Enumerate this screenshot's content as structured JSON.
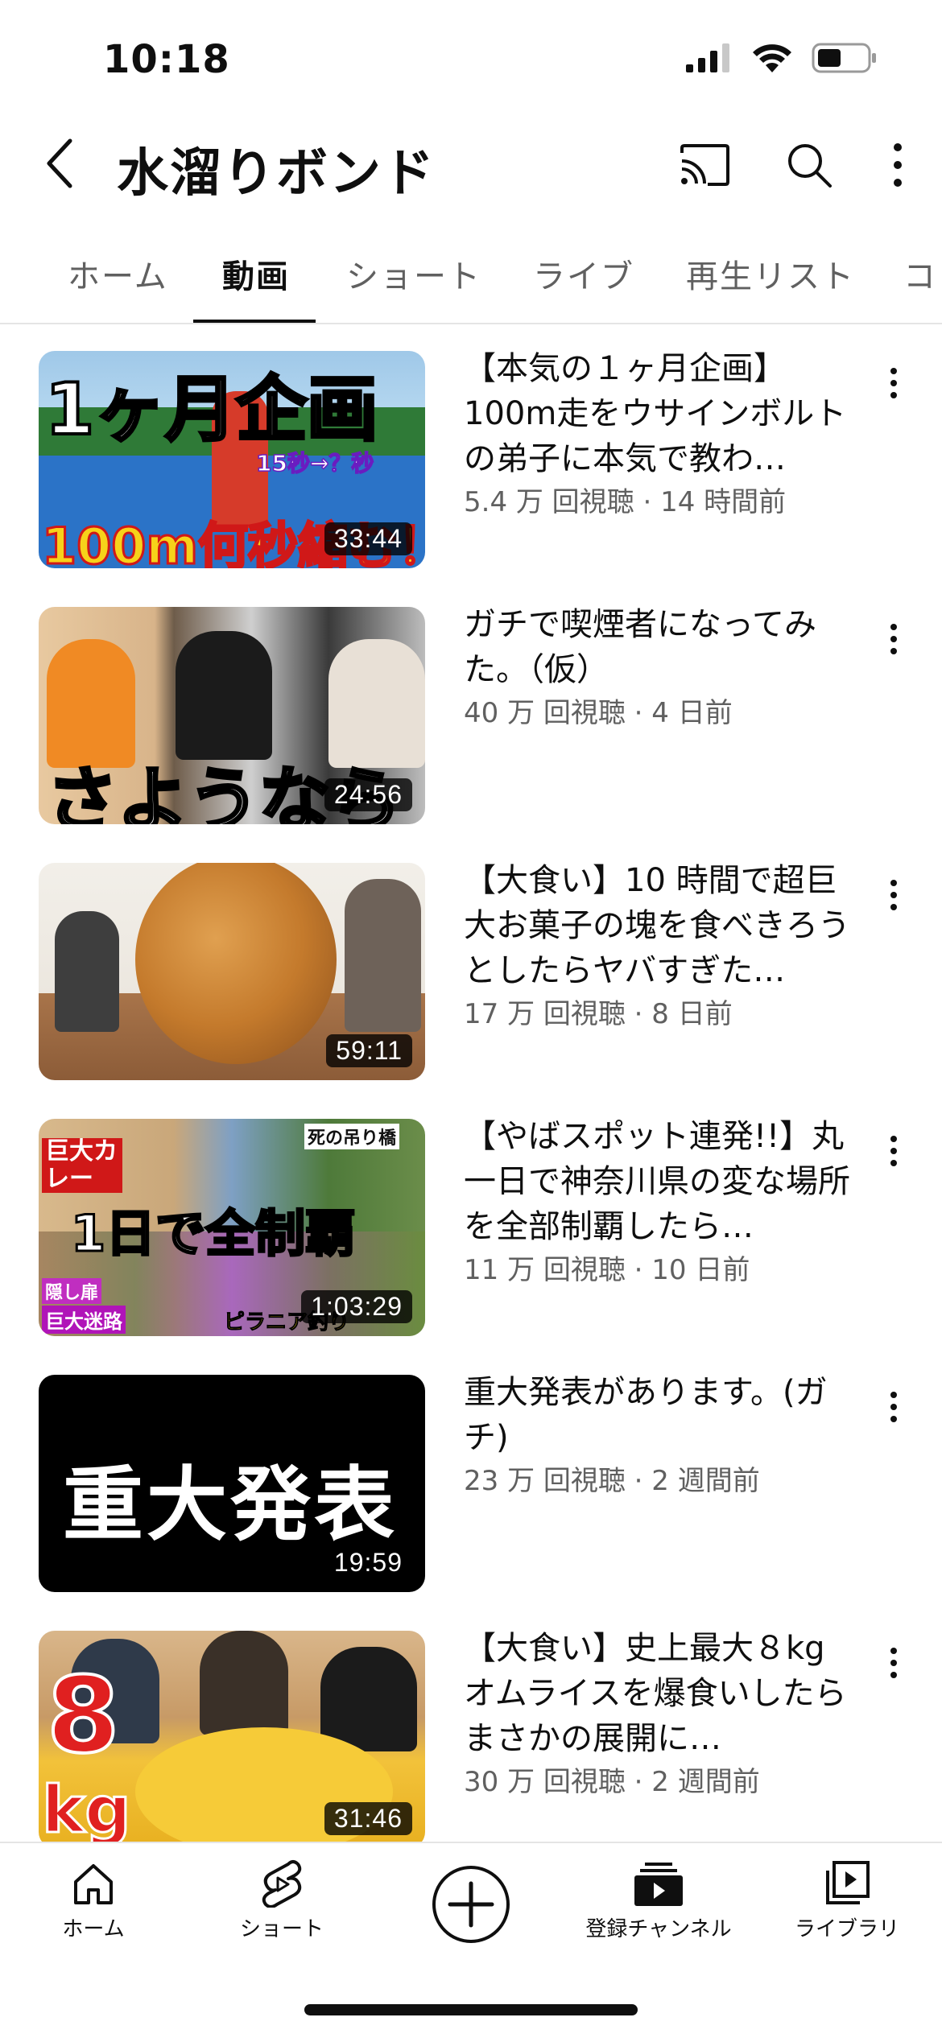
{
  "status": {
    "time": "10:18"
  },
  "header": {
    "title": "水溜りボンド"
  },
  "tabs": [
    {
      "label": "ホーム"
    },
    {
      "label": "動画",
      "active": true
    },
    {
      "label": "ショート"
    },
    {
      "label": "ライブ"
    },
    {
      "label": "再生リスト"
    },
    {
      "label": "コミュ"
    }
  ],
  "videos": [
    {
      "title": "【本気の１ヶ月企画】100m走をウサインボルトの弟子に本気で教わ…",
      "meta": "5.4 万 回視聴 · 14 時間前",
      "duration": "33:44",
      "thumb_text": {
        "top": "1ヶ月企画",
        "bottom": "100m何秒縮む！",
        "small": "15秒→？秒"
      }
    },
    {
      "title": "ガチで喫煙者になってみた。（仮）",
      "meta": "40 万 回視聴 · 4 日前",
      "duration": "24:56",
      "thumb_text": {
        "bottom": "さようなら"
      }
    },
    {
      "title": "【大食い】10 時間で超巨大お菓子の塊を食べきろうとしたらヤバすぎた…",
      "meta": "17 万 回視聴 · 8 日前",
      "duration": "59:11"
    },
    {
      "title": "【やばスポット連発!!】丸一日で神奈川県の変な場所を全部制覇したら…",
      "meta": "11 万 回視聴 · 10 日前",
      "duration": "1:03:29",
      "thumb_text": {
        "main": "1日で全制覇",
        "tl": "巨大カレー",
        "tr": "死の吊り橋",
        "bl1": "隠し扉",
        "bl2": "巨大迷路",
        "br": "ピラニア釣り"
      }
    },
    {
      "title": "重大発表があります。(ガチ)",
      "meta": "23 万 回視聴 · 2 週間前",
      "duration": "19:59",
      "thumb_text": {
        "main": "重大発表"
      }
    },
    {
      "title": "【大食い】史上最大８kg オムライスを爆食いしたらまさかの展開に…",
      "meta": "30 万 回視聴 · 2 週間前",
      "duration": "31:46",
      "thumb_text": {
        "big": "8",
        "unit": "kg"
      }
    }
  ],
  "bottom_nav": {
    "home": "ホーム",
    "shorts": "ショート",
    "subscriptions": "登録チャンネル",
    "library": "ライブラリ"
  }
}
